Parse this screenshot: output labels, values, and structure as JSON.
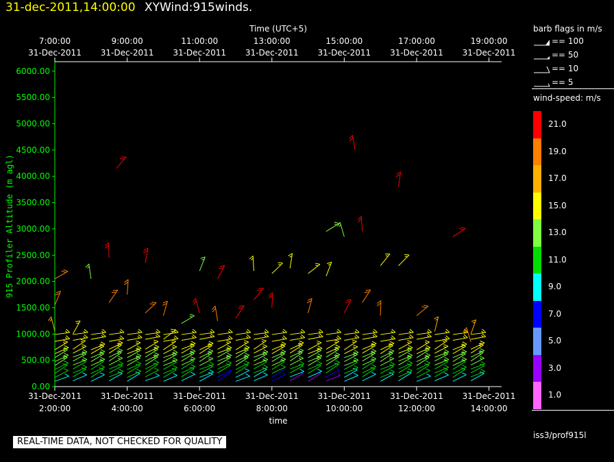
{
  "header": {
    "datetime": "31-dec-2011,14:00:00",
    "product": "XYWind:915winds."
  },
  "colors": {
    "background": "#000000",
    "header_stamp": "#ffff00",
    "y_axis": "#00ff00",
    "axis_box": "#ffffff"
  },
  "legend": {
    "flags_title": "barb flags in m/s",
    "flags": [
      {
        "symbol": "pennant",
        "label": "== 100"
      },
      {
        "symbol": "half-pennant",
        "label": "== 50"
      },
      {
        "symbol": "full-barb",
        "label": "== 10"
      },
      {
        "symbol": "half-barb",
        "label": "== 5"
      }
    ],
    "speed_title": "wind-speed: m/s",
    "speed_scale": [
      {
        "label": "21.0",
        "color": "#ff0000"
      },
      {
        "label": "19.0",
        "color": "#ff8000"
      },
      {
        "label": "17.0",
        "color": "#ffb000"
      },
      {
        "label": "15.0",
        "color": "#ffff00"
      },
      {
        "label": "13.0",
        "color": "#80ff40"
      },
      {
        "label": "11.0",
        "color": "#00dd00"
      },
      {
        "label": "9.0",
        "color": "#00ffff"
      },
      {
        "label": "7.0",
        "color": "#0000ff"
      },
      {
        "label": "5.0",
        "color": "#6699ff"
      },
      {
        "label": "3.0",
        "color": "#9900ff"
      },
      {
        "label": "1.0",
        "color": "#ff66ff"
      }
    ],
    "source": "iss3/prof915l"
  },
  "qc_banner": "REAL-TIME DATA, NOT CHECKED FOR QUALITY",
  "chart_data": {
    "type": "scatter",
    "subtype": "wind-barb time-height",
    "top_axis_title": "Time (UTC+5)",
    "bottom_axis_title": "time",
    "ylabel": "915 Profiler Altitude (m agl)",
    "ylim": [
      0,
      6200
    ],
    "xlim_hours_utc": [
      2.0,
      14.35
    ],
    "y_ticks": [
      "0.00",
      "500.00",
      "1000.00",
      "1500.00",
      "2000.00",
      "2500.00",
      "3000.00",
      "3500.00",
      "4000.00",
      "4500.00",
      "5000.00",
      "5500.00",
      "6000.00"
    ],
    "bottom_ticks": [
      {
        "date": "31-Dec-2011",
        "time": "2:00:00"
      },
      {
        "date": "31-Dec-2011",
        "time": "4:00:00"
      },
      {
        "date": "31-Dec-2011",
        "time": "6:00:00"
      },
      {
        "date": "31-Dec-2011",
        "time": "8:00:00"
      },
      {
        "date": "31-Dec-2011",
        "time": "10:00:00"
      },
      {
        "date": "31-Dec-2011",
        "time": "12:00:00"
      },
      {
        "date": "31-Dec-2011",
        "time": "14:00:00"
      }
    ],
    "top_ticks": [
      {
        "time": "7:00:00",
        "date": "31-Dec-2011"
      },
      {
        "time": "9:00:00",
        "date": "31-Dec-2011"
      },
      {
        "time": "11:00:00",
        "date": "31-Dec-2011"
      },
      {
        "time": "13:00:00",
        "date": "31-Dec-2011"
      },
      {
        "time": "15:00:00",
        "date": "31-Dec-2011"
      },
      {
        "time": "17:00:00",
        "date": "31-Dec-2011"
      },
      {
        "time": "19:00:00",
        "date": "31-Dec-2011"
      }
    ],
    "profile_times_utc": [
      2.0,
      2.5,
      3.0,
      3.5,
      4.0,
      4.5,
      5.0,
      5.5,
      6.0,
      6.5,
      7.0,
      7.5,
      8.0,
      8.5,
      9.0,
      9.5,
      10.0,
      10.5,
      11.0,
      11.5,
      12.0,
      12.5,
      13.0,
      13.5
    ],
    "low_level_barbs": {
      "heights_m": [
        100,
        175,
        250,
        325,
        400,
        475,
        550,
        625,
        700
      ],
      "speed_range_ms": [
        5,
        15
      ]
    },
    "upper_barbs": [
      {
        "t": 2.0,
        "z": 2050,
        "spd": 19
      },
      {
        "t": 2.0,
        "z": 1550,
        "spd": 19
      },
      {
        "t": 2.0,
        "z": 1050,
        "spd": 17
      },
      {
        "t": 2.5,
        "z": 1000,
        "spd": 15
      },
      {
        "t": 3.0,
        "z": 2050,
        "spd": 13
      },
      {
        "t": 3.5,
        "z": 1600,
        "spd": 19
      },
      {
        "t": 3.5,
        "z": 2450,
        "spd": 21
      },
      {
        "t": 3.7,
        "z": 4150,
        "spd": 21
      },
      {
        "t": 4.0,
        "z": 1750,
        "spd": 19
      },
      {
        "t": 4.5,
        "z": 1400,
        "spd": 19
      },
      {
        "t": 4.5,
        "z": 2350,
        "spd": 21
      },
      {
        "t": 5.0,
        "z": 900,
        "spd": 15
      },
      {
        "t": 5.0,
        "z": 1350,
        "spd": 19
      },
      {
        "t": 5.5,
        "z": 1200,
        "spd": 13
      },
      {
        "t": 6.0,
        "z": 2200,
        "spd": 13
      },
      {
        "t": 6.0,
        "z": 1400,
        "spd": 21
      },
      {
        "t": 6.5,
        "z": 2050,
        "spd": 21
      },
      {
        "t": 6.5,
        "z": 1250,
        "spd": 19
      },
      {
        "t": 7.0,
        "z": 1300,
        "spd": 21
      },
      {
        "t": 7.5,
        "z": 2200,
        "spd": 15
      },
      {
        "t": 7.5,
        "z": 1650,
        "spd": 21
      },
      {
        "t": 8.0,
        "z": 1500,
        "spd": 21
      },
      {
        "t": 8.0,
        "z": 2150,
        "spd": 15
      },
      {
        "t": 8.5,
        "z": 2250,
        "spd": 15
      },
      {
        "t": 9.0,
        "z": 2150,
        "spd": 15
      },
      {
        "t": 9.0,
        "z": 1400,
        "spd": 19
      },
      {
        "t": 9.5,
        "z": 2950,
        "spd": 13
      },
      {
        "t": 9.5,
        "z": 2100,
        "spd": 15
      },
      {
        "t": 10.0,
        "z": 2850,
        "spd": 13
      },
      {
        "t": 10.0,
        "z": 1400,
        "spd": 21
      },
      {
        "t": 10.3,
        "z": 4500,
        "spd": 21
      },
      {
        "t": 10.5,
        "z": 1600,
        "spd": 19
      },
      {
        "t": 10.5,
        "z": 2950,
        "spd": 21
      },
      {
        "t": 11.0,
        "z": 2300,
        "spd": 15
      },
      {
        "t": 11.0,
        "z": 1350,
        "spd": 19
      },
      {
        "t": 11.5,
        "z": 2300,
        "spd": 15
      },
      {
        "t": 11.5,
        "z": 3800,
        "spd": 21
      },
      {
        "t": 12.0,
        "z": 1350,
        "spd": 19
      },
      {
        "t": 12.5,
        "z": 1050,
        "spd": 17
      },
      {
        "t": 13.0,
        "z": 2850,
        "spd": 21
      },
      {
        "t": 13.5,
        "z": 1000,
        "spd": 17
      },
      {
        "t": 13.5,
        "z": 850,
        "spd": 19
      }
    ]
  }
}
